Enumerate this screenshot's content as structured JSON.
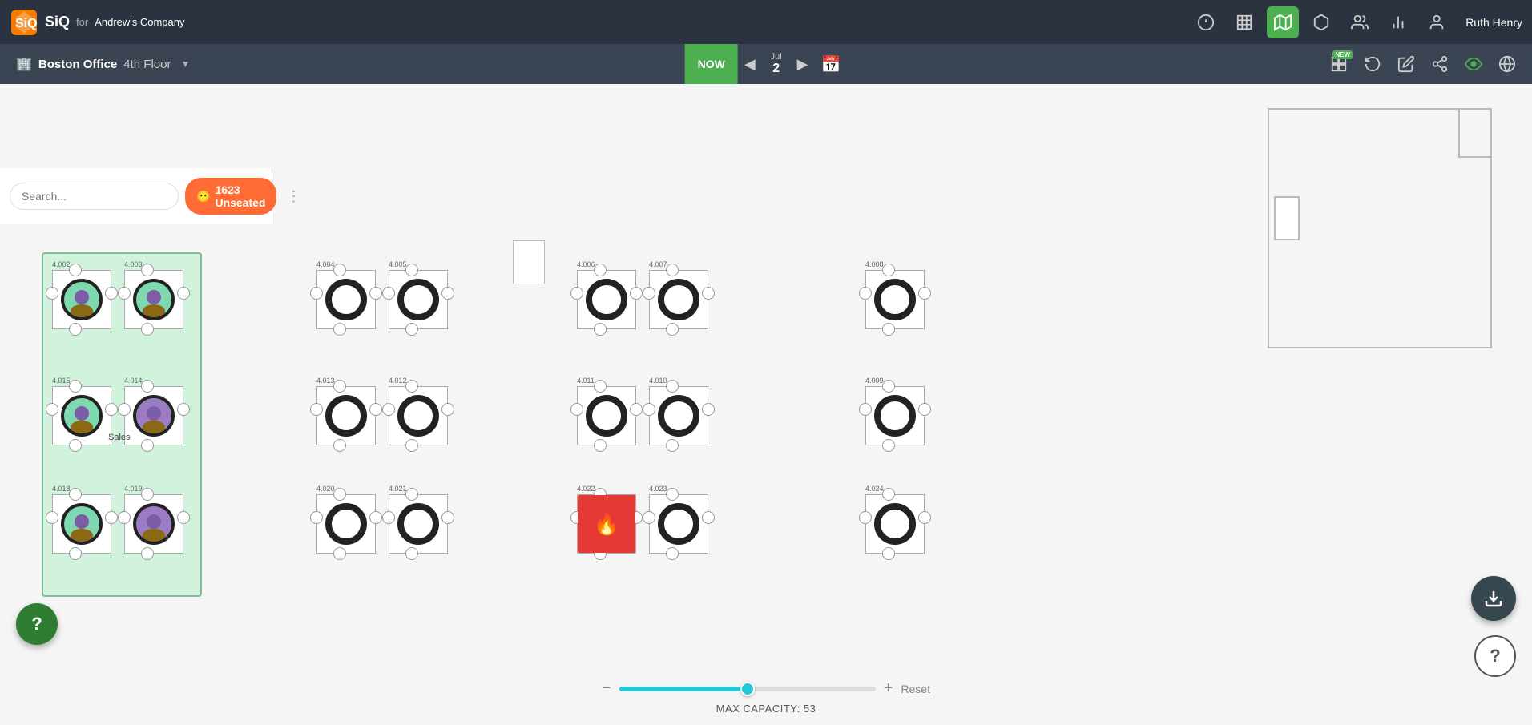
{
  "app": {
    "logo_text": "SiQ",
    "for_text": "for",
    "company": "Andrew's Company",
    "user_name": "Ruth Henry"
  },
  "nav": {
    "icons": [
      "alert-icon",
      "building-icon",
      "map-icon",
      "box-icon",
      "people-icon",
      "chart-icon"
    ],
    "active": "map-icon",
    "new_badge": "NEW"
  },
  "second_nav": {
    "building": "Boston Office",
    "floor": "4th Floor",
    "now_label": "NOW",
    "month": "Jul",
    "day": "2",
    "icons": [
      "floor-plan-icon",
      "rotate-icon",
      "edit-icon",
      "share-icon",
      "eye-icon",
      "globe-icon"
    ]
  },
  "sidebar": {
    "search_placeholder": "Search...",
    "unseated_count": "1623 Unseated",
    "unseated_icon": "😶"
  },
  "desks": {
    "green_group_label": "Sales",
    "desks_list": [
      "4.002",
      "4.003",
      "4.004",
      "4.005",
      "4.006",
      "4.007",
      "4.008",
      "4.009",
      "4.010",
      "4.011",
      "4.012",
      "4.013",
      "4.014",
      "4.015",
      "4.018",
      "4.019",
      "4.020",
      "4.021",
      "4.022",
      "4.023",
      "4.024"
    ]
  },
  "bottom": {
    "max_capacity_label": "MAX CAPACITY: 53",
    "reset_label": "Reset",
    "minus": "−",
    "plus": "+"
  },
  "fab": {
    "help_label": "?",
    "download_label": "⬇"
  }
}
